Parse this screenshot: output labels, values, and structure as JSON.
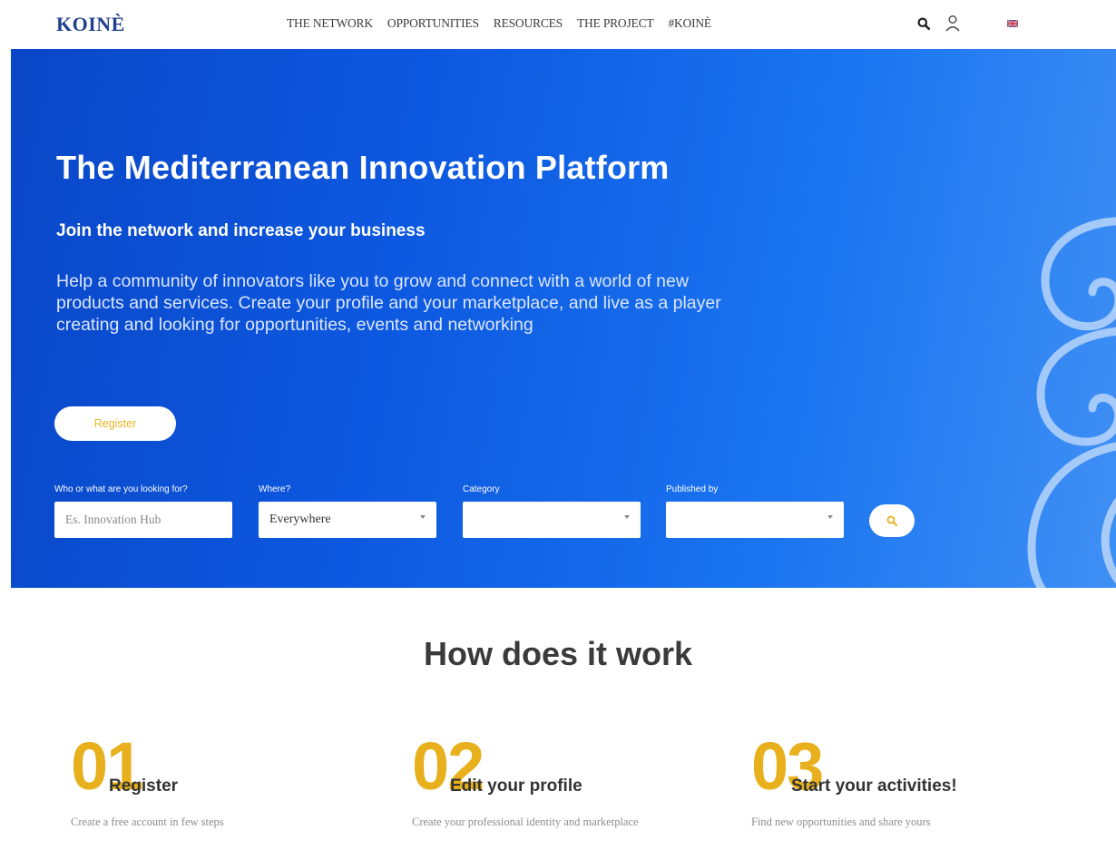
{
  "header": {
    "logo": "KOINÈ",
    "nav": [
      {
        "label": "THE NETWORK"
      },
      {
        "label": "OPPORTUNITIES"
      },
      {
        "label": "RESOURCES"
      },
      {
        "label": "THE PROJECT"
      },
      {
        "label": "#KOINÈ"
      }
    ],
    "icons": [
      "search-icon",
      "user-icon",
      "uk-flag-icon"
    ]
  },
  "hero": {
    "title": "The Mediterranean Innovation Platform",
    "subtitle": "Join the network and increase your business",
    "description": "Help a community of innovators like you to grow and connect with a world of new products and services. Create your profile and your marketplace, and live as a player creating and looking for opportunities, events and networking",
    "register_label": "Register",
    "search": {
      "what_label": "Who or what are you looking for?",
      "what_placeholder": "Es. Innovation Hub",
      "where_label": "Where?",
      "where_value": "Everywhere",
      "category_label": "Category",
      "category_value": "",
      "published_label": "Published by",
      "published_value": ""
    }
  },
  "how": {
    "title": "How does it work",
    "steps": [
      {
        "num": "01",
        "title": "Register",
        "desc": "Create a free account in few steps"
      },
      {
        "num": "02",
        "title": "Edit your profile",
        "desc": "Create your professional identity and marketplace"
      },
      {
        "num": "03",
        "title": "Start your activities!",
        "desc": "Find new opportunities and share yours"
      }
    ]
  },
  "colors": {
    "brand_blue": "#0d58e0",
    "accent_gold": "#e7b01c",
    "logo_blue": "#1f3f8f"
  }
}
